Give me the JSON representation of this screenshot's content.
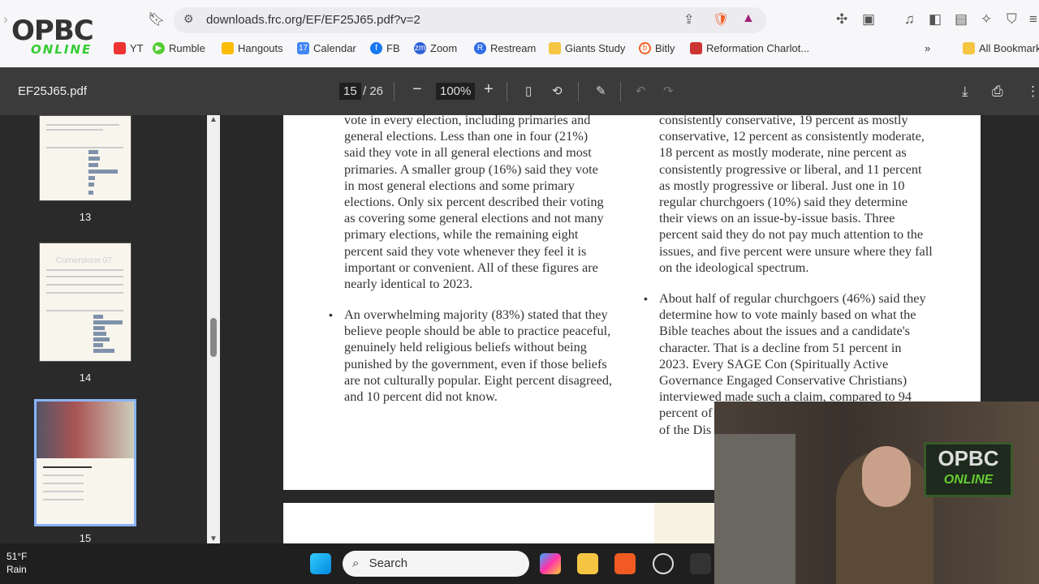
{
  "browser": {
    "url": "downloads.frc.org/EF/EF25J65.pdf?v=2",
    "bookmarks": [
      {
        "label": "YT",
        "color": "#e33"
      },
      {
        "label": "Rumble",
        "color": "#5c3"
      },
      {
        "label": "Hangouts",
        "color": "#fbbc04"
      },
      {
        "label": "Calendar",
        "color": "#4285f4"
      },
      {
        "label": "FB",
        "color": "#1877f2"
      },
      {
        "label": "Zoom",
        "color": "#2d5fd6"
      },
      {
        "label": "Restream",
        "color": "#2e6be6"
      },
      {
        "label": "Giants Study",
        "color": "#f5c542"
      },
      {
        "label": "Bitly",
        "color": "#ee6123"
      },
      {
        "label": "Reformation Charlot...",
        "color": "#c33"
      }
    ],
    "more": "»",
    "all_bookmarks": "All Bookmarks"
  },
  "overlay_logo": "OPBC",
  "overlay_logo_sub": "ONLINE",
  "pdf": {
    "filename": "EF25J65.pdf",
    "page_current": "15",
    "page_total": "/ 26",
    "zoom": "100%",
    "thumbnails": [
      "13",
      "14",
      "15"
    ],
    "thumb14_title": "Cornerstone 07",
    "left_col_para1": "vote in every election, including primaries and\ngeneral elections. Less than one in four (21%)\nsaid they vote in all general elections and most\nprimaries. A smaller group (16%) said they vote\nin most general elections and some primary\nelections. Only six percent described their voting\nas covering some general elections and not many\nprimary elections, while the remaining eight\npercent said they vote whenever they feel it is\nimportant or convenient. All of these figures are\nnearly identical to 2023.",
    "left_col_para2": "An overwhelming majority (83%) stated that they\nbelieve people should be able to practice peaceful,\ngenuinely held religious beliefs without being\npunished by the government, even if those beliefs\nare not culturally popular. Eight percent disagreed,\nand 10 percent did not know.",
    "right_col_para1": "consistently conservative, 19 percent as mostly\nconservative, 12 percent as consistently moderate,\n18 percent as mostly moderate, nine percent as\nconsistently progressive or liberal, and 11 percent\nas mostly progressive or liberal. Just one in 10\nregular churchgoers (10%) said they determine\ntheir views on an issue-by-issue basis. Three\npercent said they do not pay much attention to the\nissues, and five percent were unsure where they fall\non the ideological spectrum.",
    "right_col_para2": "About half of regular churchgoers (46%) said they\ndetermine how to vote mainly based on what the\nBible teaches about the issues and a candidate's\ncharacter. That is a decline from 51 percent in\n2023. Every SAGE Con (Spiritually Active\nGovernance Engaged Conservative Christians)\ninterviewed made such a claim, compared to 94\npercent of\nof the Dis",
    "bullet": "•"
  },
  "webcam": {
    "sign": "OPBC",
    "sign_sub": "ONLINE"
  },
  "taskbar": {
    "temp": "51°F",
    "weather": "Rain",
    "search": "Search"
  }
}
